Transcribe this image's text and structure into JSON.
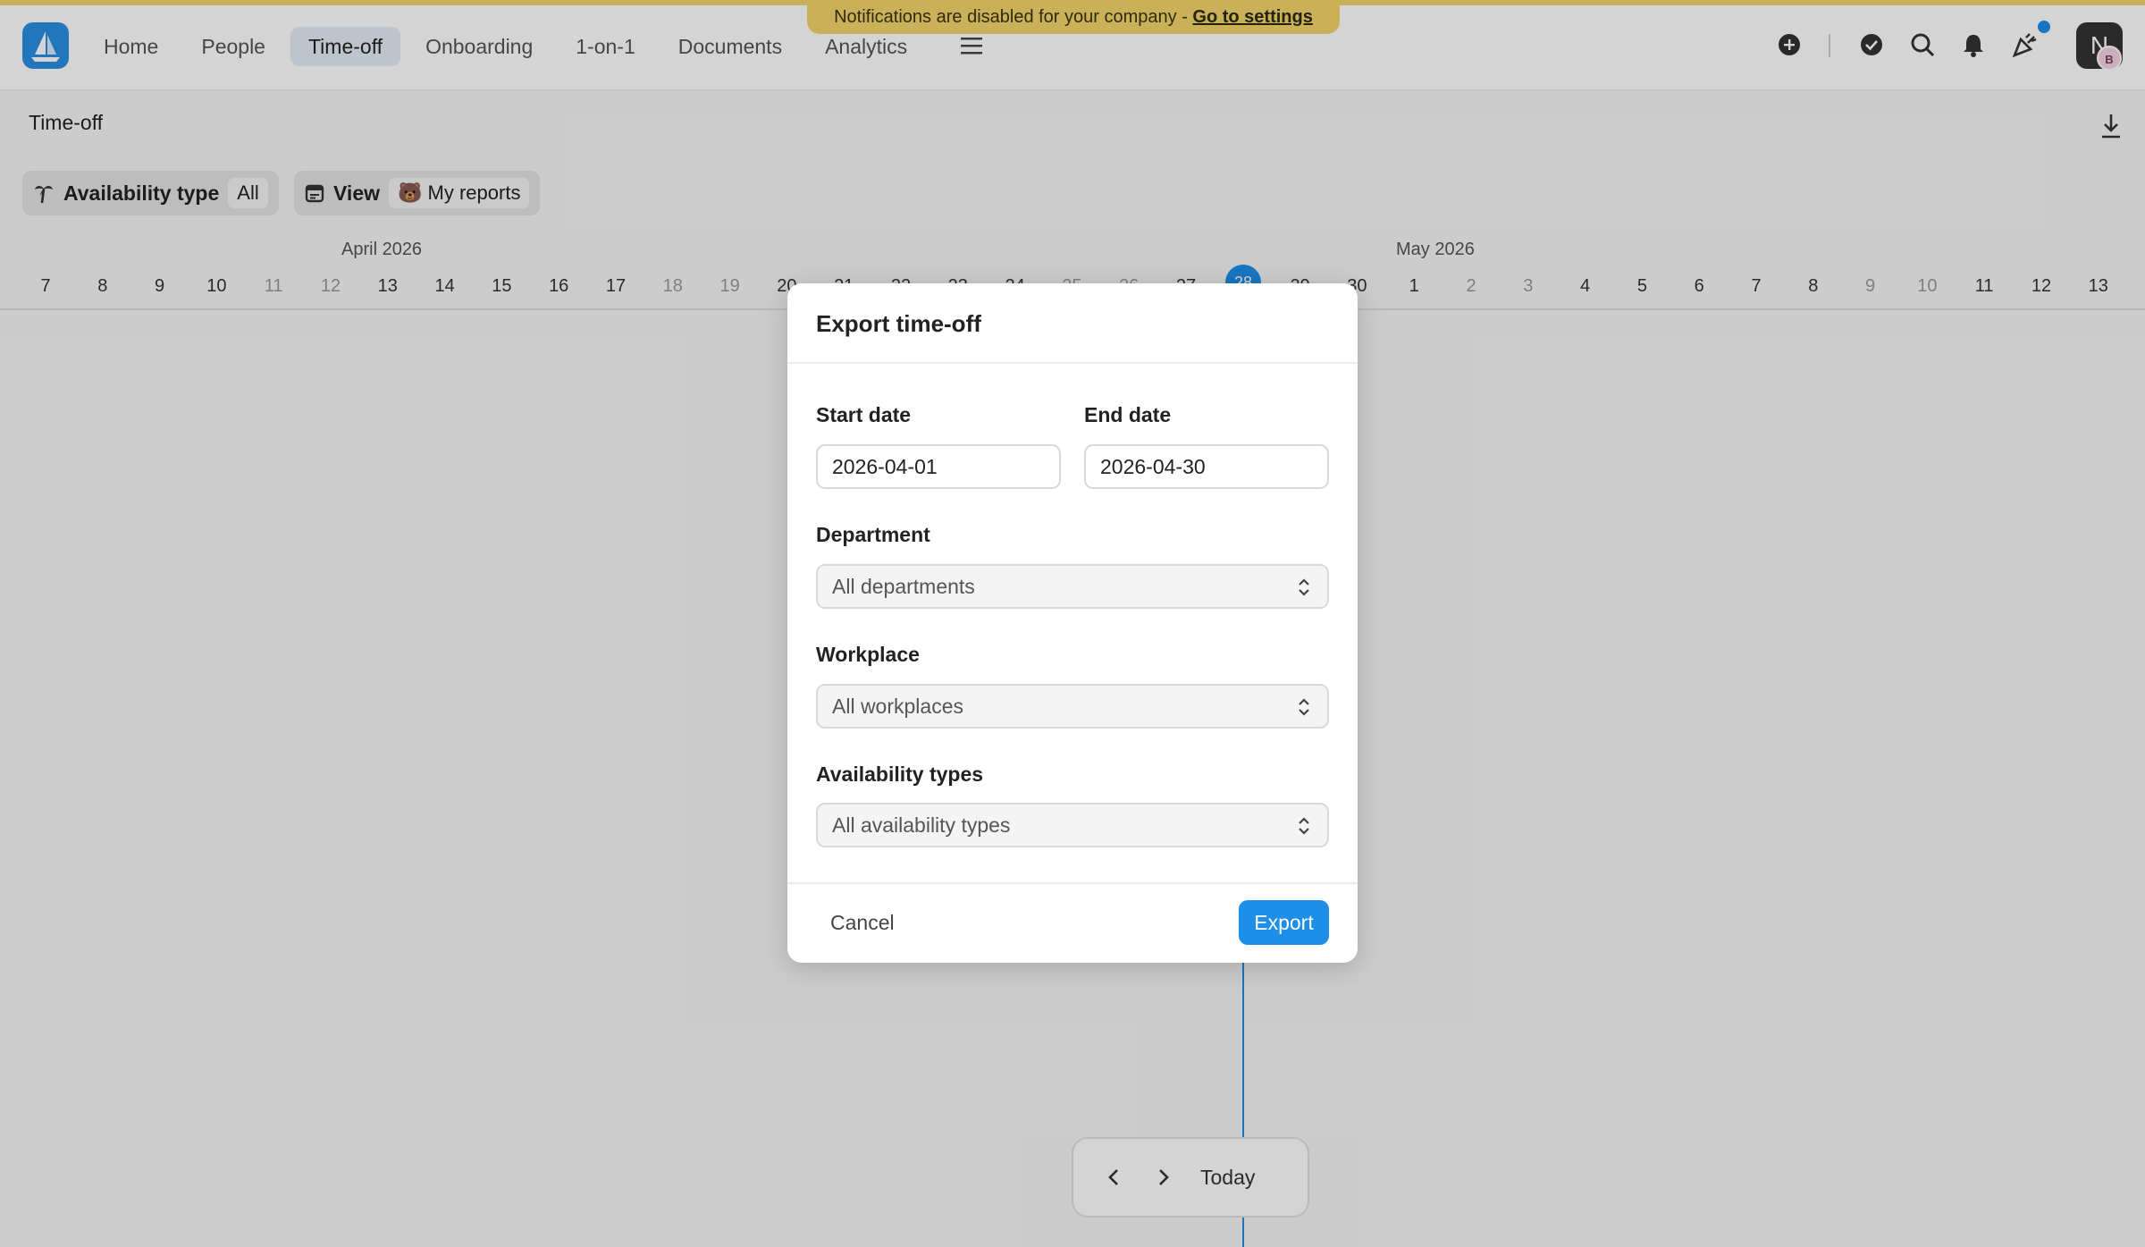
{
  "notice": {
    "text": "Notifications are disabled for your company - ",
    "link": "Go to settings"
  },
  "nav": [
    {
      "label": "Home"
    },
    {
      "label": "People"
    },
    {
      "label": "Time-off",
      "active": true
    },
    {
      "label": "Onboarding"
    },
    {
      "label": "1-on-1"
    },
    {
      "label": "Documents"
    },
    {
      "label": "Analytics"
    }
  ],
  "user": {
    "initial": "N",
    "badge": "B"
  },
  "page": {
    "title": "Time-off"
  },
  "filters": {
    "availability_label": "Availability type",
    "availability_value": "All",
    "view_label": "View",
    "view_value": "My reports"
  },
  "timeline": {
    "month_april": "April 2026",
    "month_may": "May 2026",
    "days": [
      "7",
      "8",
      "9",
      "10",
      "11",
      "12",
      "13",
      "14",
      "15",
      "16",
      "17",
      "18",
      "19",
      "20",
      "21",
      "22",
      "23",
      "24",
      "25",
      "26",
      "27",
      "28",
      "29",
      "30",
      "1",
      "2",
      "3",
      "4",
      "5",
      "6",
      "7",
      "8",
      "9",
      "10",
      "11",
      "12",
      "13"
    ],
    "today": "28"
  },
  "pager": {
    "today_label": "Today"
  },
  "modal": {
    "title": "Export time-off",
    "start_label": "Start date",
    "start_value": "2026-04-01",
    "end_label": "End date",
    "end_value": "2026-04-30",
    "department_label": "Department",
    "department_value": "All departments",
    "workplace_label": "Workplace",
    "workplace_value": "All workplaces",
    "types_label": "Availability types",
    "types_value": "All availability types",
    "cancel_label": "Cancel",
    "export_label": "Export"
  },
  "colors": {
    "accent": "#1d8fe8",
    "notice": "#f3d56b"
  }
}
